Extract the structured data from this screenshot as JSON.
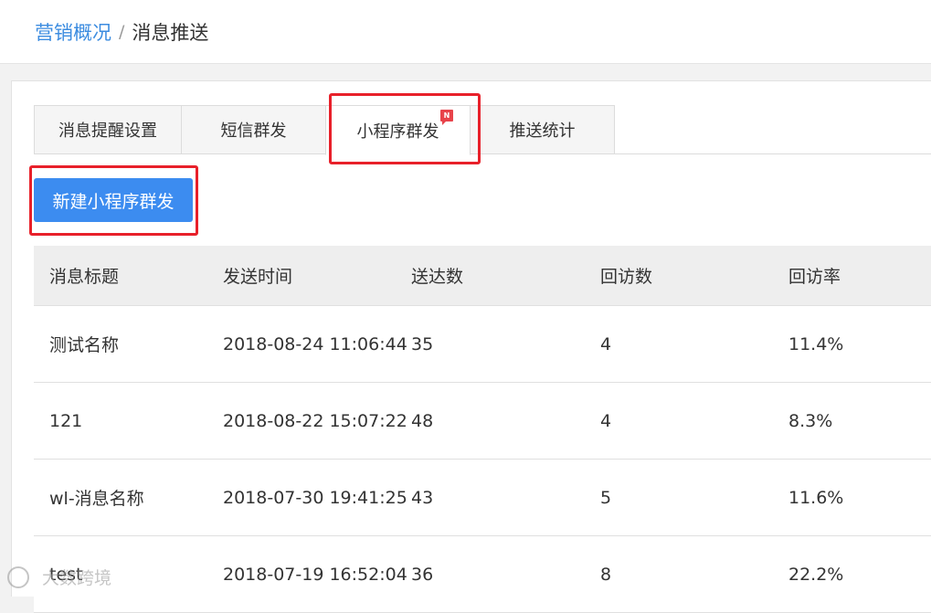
{
  "breadcrumb": {
    "parent": "营销概况",
    "separator": "/",
    "current": "消息推送"
  },
  "tabs": [
    {
      "label": "消息提醒设置",
      "active": false
    },
    {
      "label": "短信群发",
      "active": false
    },
    {
      "label": "小程序群发",
      "active": true,
      "badge": "N"
    },
    {
      "label": "推送统计",
      "active": false
    }
  ],
  "new_button_label": "新建小程序群发",
  "table": {
    "headers": [
      "消息标题",
      "发送时间",
      "送达数",
      "回访数",
      "回访率"
    ],
    "rows": [
      [
        "测试名称",
        "2018-08-24 11:06:44",
        "35",
        "4",
        "11.4%"
      ],
      [
        "121",
        "2018-08-22 15:07:22",
        "48",
        "4",
        "8.3%"
      ],
      [
        "wl-消息名称",
        "2018-07-30 19:41:25",
        "43",
        "5",
        "11.6%"
      ],
      [
        "test",
        "2018-07-19 16:52:04",
        "36",
        "8",
        "22.2%"
      ]
    ]
  },
  "watermark": "大数跨境",
  "colors": {
    "accent": "#3c8cf0",
    "highlight": "#e8202a",
    "badge": "#e8434a"
  }
}
